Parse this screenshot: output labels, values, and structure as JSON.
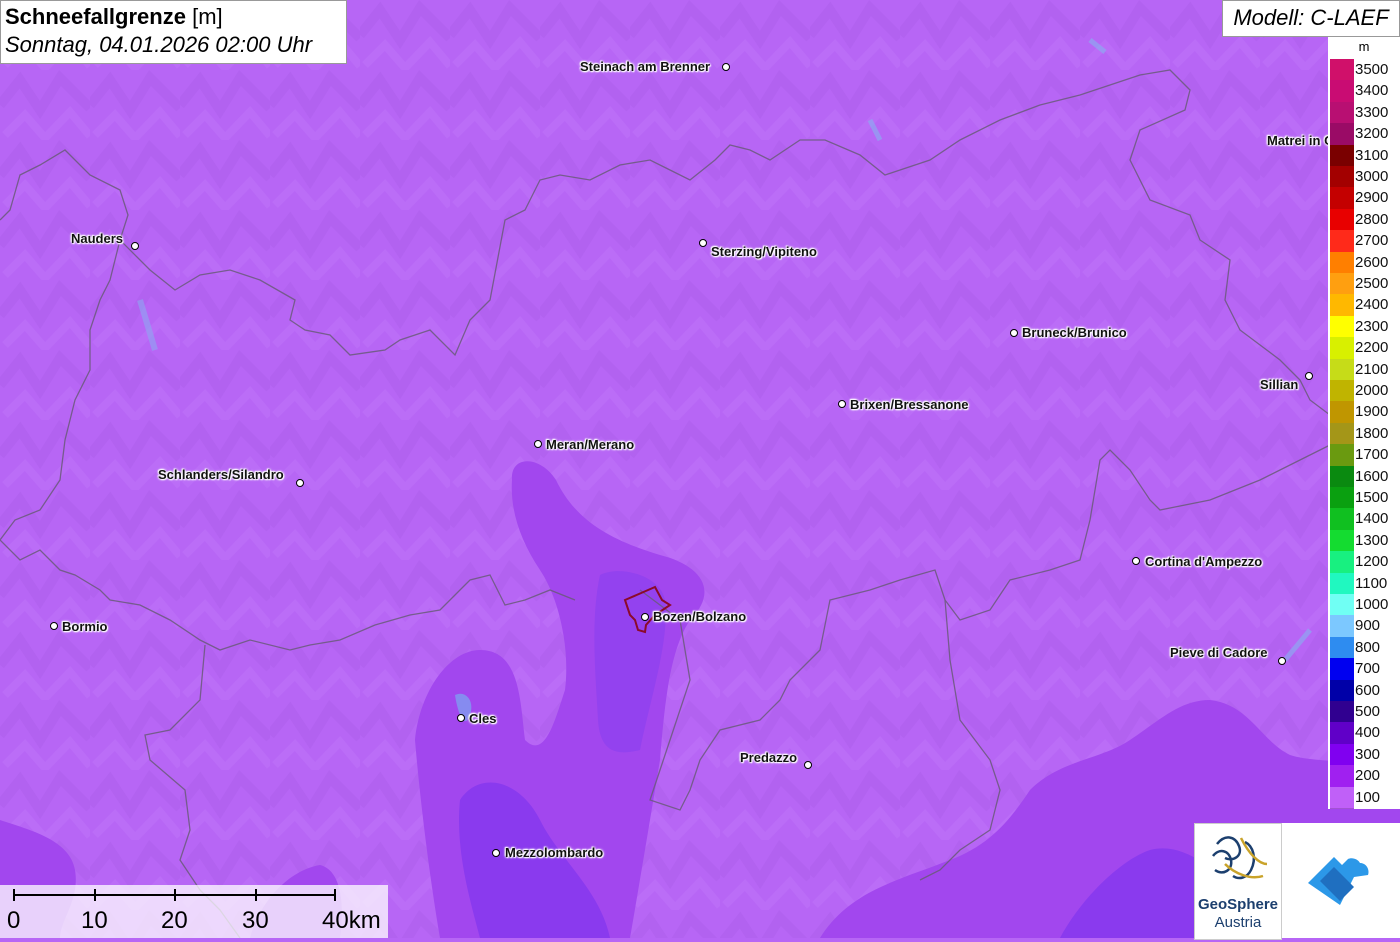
{
  "header": {
    "title": "Schneefallgrenze",
    "unit": "[m]",
    "datetime": "Sonntag, 04.01.2026 02:00 Uhr"
  },
  "model": "Modell: C-LAEF",
  "legend": {
    "unit": "m",
    "levels": [
      {
        "label": "3500",
        "color": "#d0106a"
      },
      {
        "label": "3400",
        "color": "#c90c73"
      },
      {
        "label": "3300",
        "color": "#b80f72"
      },
      {
        "label": "3200",
        "color": "#9a0b66"
      },
      {
        "label": "3100",
        "color": "#7a0000"
      },
      {
        "label": "3000",
        "color": "#a30000"
      },
      {
        "label": "2900",
        "color": "#c40000"
      },
      {
        "label": "2800",
        "color": "#e80000"
      },
      {
        "label": "2700",
        "color": "#ff2a1a"
      },
      {
        "label": "2600",
        "color": "#ff7f00"
      },
      {
        "label": "2500",
        "color": "#ff9f10"
      },
      {
        "label": "2400",
        "color": "#ffb800"
      },
      {
        "label": "2300",
        "color": "#ffff00"
      },
      {
        "label": "2200",
        "color": "#d8f000"
      },
      {
        "label": "2100",
        "color": "#c6dc18"
      },
      {
        "label": "2000",
        "color": "#c0b400"
      },
      {
        "label": "1900",
        "color": "#c09600"
      },
      {
        "label": "1800",
        "color": "#a49618"
      },
      {
        "label": "1700",
        "color": "#6a9a10"
      },
      {
        "label": "1600",
        "color": "#0a8a10"
      },
      {
        "label": "1500",
        "color": "#0aa010"
      },
      {
        "label": "1400",
        "color": "#10c020"
      },
      {
        "label": "1300",
        "color": "#14dc30"
      },
      {
        "label": "1200",
        "color": "#18f080"
      },
      {
        "label": "1100",
        "color": "#20f8c0"
      },
      {
        "label": "1000",
        "color": "#70fff4"
      },
      {
        "label": "900",
        "color": "#7cc8ff"
      },
      {
        "label": "800",
        "color": "#2e8cf0"
      },
      {
        "label": "700",
        "color": "#0000f0"
      },
      {
        "label": "600",
        "color": "#0000a8"
      },
      {
        "label": "500",
        "color": "#300090"
      },
      {
        "label": "400",
        "color": "#6000c8"
      },
      {
        "label": "300",
        "color": "#8000f0"
      },
      {
        "label": "200",
        "color": "#a020f0"
      },
      {
        "label": "100",
        "color": "#c060f8"
      }
    ]
  },
  "places": [
    {
      "name": "Steinach am Brenner"
    },
    {
      "name": "Nauders"
    },
    {
      "name": "Sterzing/Vipiteno"
    },
    {
      "name": "Matrei in Osttirol"
    },
    {
      "name": "Bruneck/Brunico"
    },
    {
      "name": "Sillian"
    },
    {
      "name": "Brixen/Bressanone"
    },
    {
      "name": "Meran/Merano"
    },
    {
      "name": "Schlanders/Silandro"
    },
    {
      "name": "Cortina d'Ampezzo"
    },
    {
      "name": "Bormio"
    },
    {
      "name": "Bozen/Bolzano"
    },
    {
      "name": "Pieve di Cadore"
    },
    {
      "name": "Cles"
    },
    {
      "name": "Predazzo"
    },
    {
      "name": "Mezzolombardo"
    }
  ],
  "scale_bar": {
    "labels": [
      "0",
      "10",
      "20",
      "30",
      "40km"
    ]
  },
  "logos": {
    "geosphere_name": "GeoSphere",
    "geosphere_sub": "Austria"
  },
  "colors": {
    "base_fill": "#b766f5",
    "low_fill": "#a247ee",
    "lowest_fill": "#8a3aee",
    "border_line": "#6a5a7a"
  }
}
